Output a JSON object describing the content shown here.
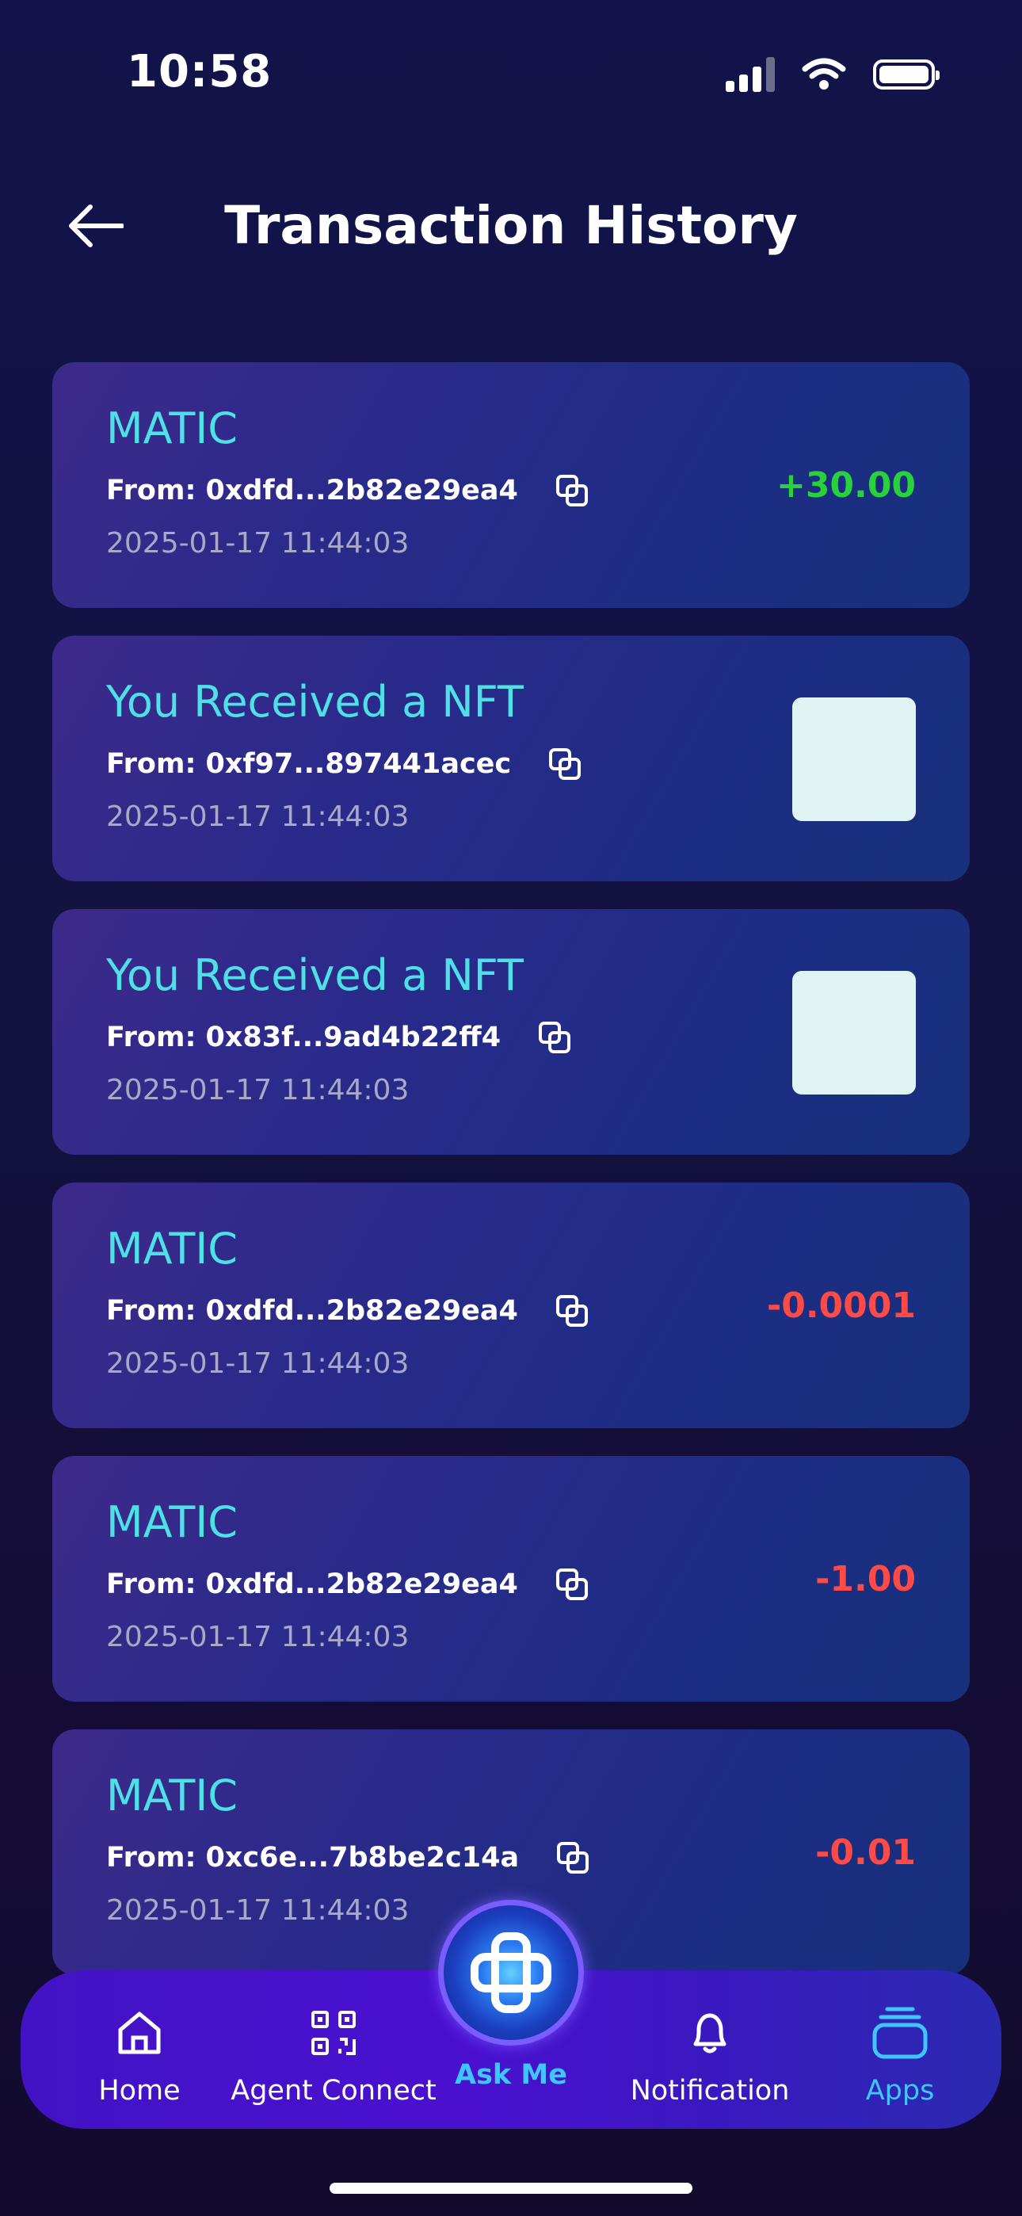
{
  "status_bar": {
    "time": "10:58"
  },
  "header": {
    "title": "Transaction History"
  },
  "transactions": [
    {
      "title": "MATIC",
      "from_label": "From:",
      "address": "0xdfd...2b82e29ea4",
      "timestamp": "2025-01-17 11:44:03",
      "amount": "+30.00",
      "kind": "amount",
      "sign": "pos"
    },
    {
      "title": "You Received a NFT",
      "from_label": "From:",
      "address": "0xf97...897441acec",
      "timestamp": "2025-01-17 11:44:03",
      "kind": "nft"
    },
    {
      "title": "You Received a NFT",
      "from_label": "From:",
      "address": "0x83f...9ad4b22ff4",
      "timestamp": "2025-01-17 11:44:03",
      "kind": "nft"
    },
    {
      "title": "MATIC",
      "from_label": "From:",
      "address": "0xdfd...2b82e29ea4",
      "timestamp": "2025-01-17 11:44:03",
      "amount": "-0.0001",
      "kind": "amount",
      "sign": "neg"
    },
    {
      "title": "MATIC",
      "from_label": "From:",
      "address": "0xdfd...2b82e29ea4",
      "timestamp": "2025-01-17 11:44:03",
      "amount": "-1.00",
      "kind": "amount",
      "sign": "neg"
    },
    {
      "title": "MATIC",
      "from_label": "From:",
      "address": "0xc6e...7b8be2c14a",
      "timestamp": "2025-01-17 11:44:03",
      "amount": "-0.01",
      "kind": "amount",
      "sign": "neg"
    }
  ],
  "bottom_nav": {
    "home": "Home",
    "agent_connect": "Agent Connect",
    "ask_me": "Ask Me",
    "notification": "Notification",
    "apps": "Apps",
    "active": "apps"
  },
  "colors": {
    "accent_cyan": "#4ee0e6",
    "positive": "#27d23a",
    "negative": "#ff4a45",
    "nav_active": "#3fc6ff"
  }
}
